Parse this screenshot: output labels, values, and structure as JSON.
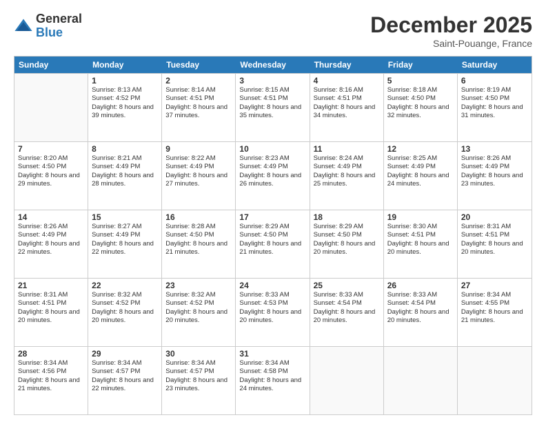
{
  "logo": {
    "general": "General",
    "blue": "Blue"
  },
  "header": {
    "month": "December 2025",
    "location": "Saint-Pouange, France"
  },
  "days": [
    "Sunday",
    "Monday",
    "Tuesday",
    "Wednesday",
    "Thursday",
    "Friday",
    "Saturday"
  ],
  "weeks": [
    [
      {
        "day": "",
        "empty": true
      },
      {
        "day": "1",
        "sunrise": "Sunrise: 8:13 AM",
        "sunset": "Sunset: 4:52 PM",
        "daylight": "Daylight: 8 hours and 39 minutes."
      },
      {
        "day": "2",
        "sunrise": "Sunrise: 8:14 AM",
        "sunset": "Sunset: 4:51 PM",
        "daylight": "Daylight: 8 hours and 37 minutes."
      },
      {
        "day": "3",
        "sunrise": "Sunrise: 8:15 AM",
        "sunset": "Sunset: 4:51 PM",
        "daylight": "Daylight: 8 hours and 35 minutes."
      },
      {
        "day": "4",
        "sunrise": "Sunrise: 8:16 AM",
        "sunset": "Sunset: 4:51 PM",
        "daylight": "Daylight: 8 hours and 34 minutes."
      },
      {
        "day": "5",
        "sunrise": "Sunrise: 8:18 AM",
        "sunset": "Sunset: 4:50 PM",
        "daylight": "Daylight: 8 hours and 32 minutes."
      },
      {
        "day": "6",
        "sunrise": "Sunrise: 8:19 AM",
        "sunset": "Sunset: 4:50 PM",
        "daylight": "Daylight: 8 hours and 31 minutes."
      }
    ],
    [
      {
        "day": "7",
        "sunrise": "Sunrise: 8:20 AM",
        "sunset": "Sunset: 4:50 PM",
        "daylight": "Daylight: 8 hours and 29 minutes."
      },
      {
        "day": "8",
        "sunrise": "Sunrise: 8:21 AM",
        "sunset": "Sunset: 4:49 PM",
        "daylight": "Daylight: 8 hours and 28 minutes."
      },
      {
        "day": "9",
        "sunrise": "Sunrise: 8:22 AM",
        "sunset": "Sunset: 4:49 PM",
        "daylight": "Daylight: 8 hours and 27 minutes."
      },
      {
        "day": "10",
        "sunrise": "Sunrise: 8:23 AM",
        "sunset": "Sunset: 4:49 PM",
        "daylight": "Daylight: 8 hours and 26 minutes."
      },
      {
        "day": "11",
        "sunrise": "Sunrise: 8:24 AM",
        "sunset": "Sunset: 4:49 PM",
        "daylight": "Daylight: 8 hours and 25 minutes."
      },
      {
        "day": "12",
        "sunrise": "Sunrise: 8:25 AM",
        "sunset": "Sunset: 4:49 PM",
        "daylight": "Daylight: 8 hours and 24 minutes."
      },
      {
        "day": "13",
        "sunrise": "Sunrise: 8:26 AM",
        "sunset": "Sunset: 4:49 PM",
        "daylight": "Daylight: 8 hours and 23 minutes."
      }
    ],
    [
      {
        "day": "14",
        "sunrise": "Sunrise: 8:26 AM",
        "sunset": "Sunset: 4:49 PM",
        "daylight": "Daylight: 8 hours and 22 minutes."
      },
      {
        "day": "15",
        "sunrise": "Sunrise: 8:27 AM",
        "sunset": "Sunset: 4:49 PM",
        "daylight": "Daylight: 8 hours and 22 minutes."
      },
      {
        "day": "16",
        "sunrise": "Sunrise: 8:28 AM",
        "sunset": "Sunset: 4:50 PM",
        "daylight": "Daylight: 8 hours and 21 minutes."
      },
      {
        "day": "17",
        "sunrise": "Sunrise: 8:29 AM",
        "sunset": "Sunset: 4:50 PM",
        "daylight": "Daylight: 8 hours and 21 minutes."
      },
      {
        "day": "18",
        "sunrise": "Sunrise: 8:29 AM",
        "sunset": "Sunset: 4:50 PM",
        "daylight": "Daylight: 8 hours and 20 minutes."
      },
      {
        "day": "19",
        "sunrise": "Sunrise: 8:30 AM",
        "sunset": "Sunset: 4:51 PM",
        "daylight": "Daylight: 8 hours and 20 minutes."
      },
      {
        "day": "20",
        "sunrise": "Sunrise: 8:31 AM",
        "sunset": "Sunset: 4:51 PM",
        "daylight": "Daylight: 8 hours and 20 minutes."
      }
    ],
    [
      {
        "day": "21",
        "sunrise": "Sunrise: 8:31 AM",
        "sunset": "Sunset: 4:51 PM",
        "daylight": "Daylight: 8 hours and 20 minutes."
      },
      {
        "day": "22",
        "sunrise": "Sunrise: 8:32 AM",
        "sunset": "Sunset: 4:52 PM",
        "daylight": "Daylight: 8 hours and 20 minutes."
      },
      {
        "day": "23",
        "sunrise": "Sunrise: 8:32 AM",
        "sunset": "Sunset: 4:52 PM",
        "daylight": "Daylight: 8 hours and 20 minutes."
      },
      {
        "day": "24",
        "sunrise": "Sunrise: 8:33 AM",
        "sunset": "Sunset: 4:53 PM",
        "daylight": "Daylight: 8 hours and 20 minutes."
      },
      {
        "day": "25",
        "sunrise": "Sunrise: 8:33 AM",
        "sunset": "Sunset: 4:54 PM",
        "daylight": "Daylight: 8 hours and 20 minutes."
      },
      {
        "day": "26",
        "sunrise": "Sunrise: 8:33 AM",
        "sunset": "Sunset: 4:54 PM",
        "daylight": "Daylight: 8 hours and 20 minutes."
      },
      {
        "day": "27",
        "sunrise": "Sunrise: 8:34 AM",
        "sunset": "Sunset: 4:55 PM",
        "daylight": "Daylight: 8 hours and 21 minutes."
      }
    ],
    [
      {
        "day": "28",
        "sunrise": "Sunrise: 8:34 AM",
        "sunset": "Sunset: 4:56 PM",
        "daylight": "Daylight: 8 hours and 21 minutes."
      },
      {
        "day": "29",
        "sunrise": "Sunrise: 8:34 AM",
        "sunset": "Sunset: 4:57 PM",
        "daylight": "Daylight: 8 hours and 22 minutes."
      },
      {
        "day": "30",
        "sunrise": "Sunrise: 8:34 AM",
        "sunset": "Sunset: 4:57 PM",
        "daylight": "Daylight: 8 hours and 23 minutes."
      },
      {
        "day": "31",
        "sunrise": "Sunrise: 8:34 AM",
        "sunset": "Sunset: 4:58 PM",
        "daylight": "Daylight: 8 hours and 24 minutes."
      },
      {
        "day": "",
        "empty": true
      },
      {
        "day": "",
        "empty": true
      },
      {
        "day": "",
        "empty": true
      }
    ]
  ]
}
